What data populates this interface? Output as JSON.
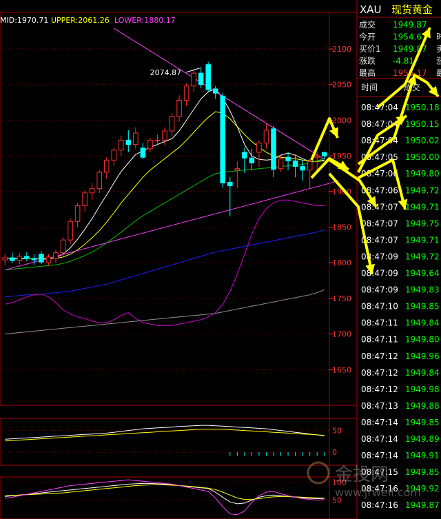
{
  "chart_data": {
    "type": "candlestick",
    "indicator_header": {
      "mid_label": "MID:1970.71",
      "upper_label": "UPPER:2061.26",
      "lower_label": "LOWER:1880.17"
    },
    "price_axis": {
      "ylim": [
        1600,
        2130
      ],
      "ticks": [
        2100,
        2050,
        2000,
        1950,
        1900,
        1850,
        1800,
        1750,
        1700,
        1650
      ]
    },
    "annotation": {
      "label": "2074.87",
      "price": 2074.87
    },
    "candles": [
      {
        "o": 1804,
        "h": 1812,
        "l": 1796,
        "c": 1807
      },
      {
        "o": 1807,
        "h": 1814,
        "l": 1800,
        "c": 1803
      },
      {
        "o": 1803,
        "h": 1813,
        "l": 1798,
        "c": 1809
      },
      {
        "o": 1809,
        "h": 1815,
        "l": 1802,
        "c": 1806
      },
      {
        "o": 1806,
        "h": 1812,
        "l": 1797,
        "c": 1804
      },
      {
        "o": 1812,
        "h": 1816,
        "l": 1798,
        "c": 1801
      },
      {
        "o": 1800,
        "h": 1812,
        "l": 1796,
        "c": 1808
      },
      {
        "o": 1806,
        "h": 1818,
        "l": 1800,
        "c": 1814
      },
      {
        "o": 1814,
        "h": 1836,
        "l": 1810,
        "c": 1832
      },
      {
        "o": 1832,
        "h": 1862,
        "l": 1826,
        "c": 1858
      },
      {
        "o": 1858,
        "h": 1884,
        "l": 1850,
        "c": 1880
      },
      {
        "o": 1880,
        "h": 1902,
        "l": 1872,
        "c": 1898
      },
      {
        "o": 1898,
        "h": 1912,
        "l": 1888,
        "c": 1904
      },
      {
        "o": 1904,
        "h": 1930,
        "l": 1898,
        "c": 1927
      },
      {
        "o": 1927,
        "h": 1948,
        "l": 1918,
        "c": 1944
      },
      {
        "o": 1944,
        "h": 1962,
        "l": 1936,
        "c": 1958
      },
      {
        "o": 1958,
        "h": 1978,
        "l": 1950,
        "c": 1972
      },
      {
        "o": 1972,
        "h": 1986,
        "l": 1955,
        "c": 1966
      },
      {
        "o": 1966,
        "h": 1990,
        "l": 1960,
        "c": 1982
      },
      {
        "o": 1961,
        "h": 1968,
        "l": 1945,
        "c": 1948
      },
      {
        "o": 1960,
        "h": 1975,
        "l": 1955,
        "c": 1972
      },
      {
        "o": 1972,
        "h": 1980,
        "l": 1966,
        "c": 1972
      },
      {
        "o": 1972,
        "h": 1990,
        "l": 1965,
        "c": 1985
      },
      {
        "o": 1985,
        "h": 2010,
        "l": 1978,
        "c": 2005
      },
      {
        "o": 2005,
        "h": 2035,
        "l": 1998,
        "c": 2028
      },
      {
        "o": 2028,
        "h": 2052,
        "l": 2020,
        "c": 2048
      },
      {
        "o": 2048,
        "h": 2072,
        "l": 2040,
        "c": 2066
      },
      {
        "o": 2066,
        "h": 2074.87,
        "l": 2045,
        "c": 2050
      },
      {
        "o": 2078,
        "h": 2082,
        "l": 2040,
        "c": 2043
      },
      {
        "o": 2044,
        "h": 2048,
        "l": 2030,
        "c": 2038
      },
      {
        "o": 2034,
        "h": 2038,
        "l": 1905,
        "c": 1912
      },
      {
        "o": 1913,
        "h": 1920,
        "l": 1865,
        "c": 1908
      },
      {
        "o": 1930,
        "h": 1942,
        "l": 1905,
        "c": 1932
      },
      {
        "o": 1955,
        "h": 1962,
        "l": 1926,
        "c": 1947
      },
      {
        "o": 1947,
        "h": 1960,
        "l": 1930,
        "c": 1940
      },
      {
        "o": 1955,
        "h": 1972,
        "l": 1935,
        "c": 1968
      },
      {
        "o": 1968,
        "h": 1995,
        "l": 1960,
        "c": 1986
      },
      {
        "o": 1988,
        "h": 1992,
        "l": 1920,
        "c": 1931
      },
      {
        "o": 1932,
        "h": 1950,
        "l": 1928,
        "c": 1946
      },
      {
        "o": 1948,
        "h": 1955,
        "l": 1930,
        "c": 1943
      },
      {
        "o": 1943,
        "h": 1950,
        "l": 1920,
        "c": 1935
      },
      {
        "o": 1935,
        "h": 1945,
        "l": 1915,
        "c": 1930
      },
      {
        "o": 1930,
        "h": 1946,
        "l": 1905,
        "c": 1942
      },
      {
        "o": 1948,
        "h": 1955,
        "l": 1930,
        "c": 1950
      },
      {
        "o": 1954.6,
        "h": 1956.2,
        "l": 1945,
        "c": 1949.87
      }
    ],
    "moving_averages": [
      {
        "color": "#ffffff",
        "values": [
          1806,
          1806,
          1805,
          1806,
          1806,
          1806,
          1805,
          1807,
          1812,
          1821,
          1833,
          1847,
          1862,
          1879,
          1895,
          1912,
          1928,
          1940,
          1952,
          1957,
          1962,
          1966,
          1970,
          1974,
          1985,
          2000,
          2015,
          2030,
          2040,
          2044,
          2031,
          2013,
          1991,
          1966,
          1950,
          1945,
          1944,
          1945,
          1951,
          1954,
          1951,
          1946,
          1942,
          1942,
          1944
        ]
      },
      {
        "color": "#ffff00",
        "values": [
          1806,
          1806,
          1806,
          1806,
          1806,
          1806,
          1806,
          1806,
          1808,
          1812,
          1818,
          1826,
          1835,
          1845,
          1857,
          1870,
          1884,
          1896,
          1908,
          1920,
          1930,
          1938,
          1946,
          1954,
          1962,
          1972,
          1983,
          1994,
          2004,
          2012,
          2010,
          2002,
          1991,
          1980,
          1970,
          1962,
          1955,
          1950,
          1948,
          1947,
          1946,
          1944,
          1943,
          1942,
          1943
        ]
      },
      {
        "color": "#00c000",
        "values": [
          1790,
          1791,
          1792,
          1793,
          1794,
          1795,
          1796,
          1797,
          1799,
          1802,
          1806,
          1810,
          1815,
          1821,
          1828,
          1835,
          1843,
          1851,
          1859,
          1866,
          1872,
          1878,
          1884,
          1890,
          1896,
          1902,
          1908,
          1914,
          1920,
          1925,
          1927,
          1928,
          1929,
          1930,
          1931,
          1932,
          1933,
          1934,
          1935,
          1936,
          1937,
          1938,
          1940,
          1943,
          1946
        ]
      },
      {
        "color": "#2020ff",
        "values": [
          1752,
          1753,
          1754,
          1755,
          1755,
          1756,
          1757,
          1758,
          1759,
          1760,
          1762,
          1764,
          1766,
          1768,
          1770,
          1773,
          1776,
          1779,
          1782,
          1785,
          1788,
          1791,
          1794,
          1797,
          1800,
          1803,
          1806,
          1809,
          1812,
          1815,
          1817,
          1819,
          1821,
          1823,
          1825,
          1827,
          1829,
          1831,
          1833,
          1835,
          1837,
          1839,
          1841,
          1843,
          1846
        ]
      },
      {
        "color": "#909090",
        "values": [
          1700,
          1701,
          1702,
          1703,
          1704,
          1705,
          1706,
          1707,
          1708,
          1709,
          1710,
          1711,
          1712,
          1713,
          1714,
          1715,
          1716,
          1717,
          1718,
          1719,
          1720,
          1721,
          1722,
          1723,
          1724,
          1725,
          1726,
          1727,
          1728,
          1729,
          1731,
          1733,
          1735,
          1737,
          1739,
          1741,
          1743,
          1745,
          1747,
          1749,
          1751,
          1753,
          1755,
          1758,
          1762
        ]
      },
      {
        "color": "#d000d0",
        "values": [
          1742,
          1744,
          1748,
          1752,
          1755,
          1756,
          1752,
          1744,
          1734,
          1728,
          1724,
          1722,
          1718,
          1716,
          1716,
          1720,
          1726,
          1730,
          1722,
          1716,
          1714,
          1712,
          1712,
          1712,
          1714,
          1716,
          1718,
          1720,
          1724,
          1730,
          1742,
          1760,
          1784,
          1812,
          1840,
          1862,
          1876,
          1884,
          1888,
          1888,
          1886,
          1884,
          1882,
          1880,
          1880
        ]
      }
    ],
    "trendlines": [
      {
        "color": "#ff40ff",
        "from": [
          15,
          2129
        ],
        "to": [
          44,
          1945
        ]
      },
      {
        "color": "#ff40ff",
        "from": [
          0,
          1790
        ],
        "to": [
          46,
          1915
        ]
      }
    ],
    "macd_panel": {
      "ticks": [
        50,
        0
      ],
      "ylim": [
        -25,
        70
      ],
      "dif": [
        30,
        31,
        32,
        33,
        34,
        35,
        36,
        37,
        38,
        39,
        40,
        41,
        42,
        43,
        44,
        46,
        48,
        50,
        52,
        54,
        55,
        56,
        57,
        58,
        59,
        60,
        61,
        62,
        62,
        61,
        60,
        59,
        58,
        57,
        56,
        55,
        54,
        52,
        50,
        48,
        46,
        44,
        42,
        40,
        38
      ],
      "dea": [
        26,
        27,
        28,
        29,
        30,
        31,
        32,
        33,
        34,
        35,
        36,
        37,
        38,
        39,
        40,
        41,
        42,
        43,
        44,
        45,
        46,
        47,
        48,
        49,
        50,
        51,
        52,
        53,
        53,
        53,
        53,
        52,
        51,
        50,
        49,
        48,
        47,
        46,
        45,
        44,
        43,
        42,
        41,
        40,
        39
      ],
      "histogram": [
        0,
        0,
        0,
        0,
        0,
        0,
        0,
        0,
        0,
        0,
        0,
        0,
        0,
        0,
        0,
        0,
        0,
        0,
        0,
        0,
        0,
        0,
        0,
        0,
        0,
        0,
        0,
        0,
        0,
        0,
        0,
        -8,
        -8,
        -8,
        -8,
        -8,
        -8,
        -8,
        -8,
        -8,
        -8,
        -8,
        -8,
        -8,
        -8
      ]
    },
    "kdj_panel": {
      "ticks": [
        100,
        50
      ],
      "ylim": [
        0,
        110
      ],
      "k": [
        60,
        62,
        64,
        66,
        68,
        70,
        72,
        74,
        76,
        78,
        80,
        82,
        84,
        86,
        88,
        90,
        92,
        94,
        95,
        96,
        96,
        95,
        94,
        92,
        90,
        88,
        86,
        84,
        82,
        72,
        58,
        45,
        40,
        42,
        50,
        58,
        62,
        64,
        62,
        60,
        58,
        56,
        55,
        54,
        55
      ],
      "d": [
        62,
        63,
        64,
        65,
        66,
        67,
        68,
        69,
        70,
        72,
        74,
        76,
        78,
        80,
        82,
        84,
        86,
        88,
        90,
        91,
        92,
        92,
        92,
        91,
        90,
        89,
        87,
        85,
        83,
        79,
        72,
        64,
        56,
        52,
        52,
        54,
        57,
        59,
        60,
        60,
        59,
        58,
        57,
        56,
        56
      ],
      "j": [
        55,
        58,
        62,
        66,
        70,
        74,
        78,
        82,
        86,
        90,
        92,
        94,
        96,
        98,
        100,
        102,
        104,
        106,
        104,
        102,
        100,
        98,
        96,
        94,
        90,
        86,
        82,
        78,
        74,
        56,
        32,
        12,
        10,
        20,
        44,
        62,
        72,
        74,
        68,
        62,
        58,
        54,
        52,
        50,
        52
      ]
    }
  },
  "quote_panel": {
    "symbol": "XAU",
    "name": "现货黄金",
    "rows": [
      {
        "label": "成交",
        "value": "1949.87",
        "right": ""
      },
      {
        "label": "今开",
        "value": "1954.67",
        "right": "时"
      },
      {
        "label": "买价1",
        "value": "1949.87",
        "right": "卖"
      },
      {
        "label": "涨跌",
        "value": "-4.81",
        "right": "涨"
      },
      {
        "label": "最高",
        "value": "1955.17",
        "right": "最"
      }
    ],
    "ticks_header": {
      "time": "时间",
      "price": "成交"
    },
    "ticks": [
      {
        "time": "08:47:04",
        "price": "1950.18",
        "color": "#00ff00"
      },
      {
        "time": "08:47:04",
        "price": "1950.15",
        "color": "#00ff00"
      },
      {
        "time": "08:47:04",
        "price": "1950.02",
        "color": "#00ff00"
      },
      {
        "time": "08:47:05",
        "price": "1950.00",
        "color": "#00ff00"
      },
      {
        "time": "08:47:06",
        "price": "1949.80",
        "color": "#00ff00"
      },
      {
        "time": "08:47:06",
        "price": "1949.72",
        "color": "#00ff00"
      },
      {
        "time": "08:47:07",
        "price": "1949.71",
        "color": "#00ff00"
      },
      {
        "time": "08:47:07",
        "price": "1949.75",
        "color": "#00ff00"
      },
      {
        "time": "08:47:07",
        "price": "1949.71",
        "color": "#00ff00"
      },
      {
        "time": "08:47:09",
        "price": "1949.72",
        "color": "#00ff00"
      },
      {
        "time": "08:47:09",
        "price": "1949.64",
        "color": "#00ff00"
      },
      {
        "time": "08:47:09",
        "price": "1949.83",
        "color": "#00ff00"
      },
      {
        "time": "08:47:10",
        "price": "1949.85",
        "color": "#00ff00"
      },
      {
        "time": "08:47:11",
        "price": "1949.84",
        "color": "#00ff00"
      },
      {
        "time": "08:47:11",
        "price": "1949.80",
        "color": "#00ff00"
      },
      {
        "time": "08:47:12",
        "price": "1949.96",
        "color": "#00ff00"
      },
      {
        "time": "08:47:12",
        "price": "1949.84",
        "color": "#00ff00"
      },
      {
        "time": "08:47:12",
        "price": "1949.98",
        "color": "#00ff00"
      },
      {
        "time": "08:47:13",
        "price": "1949.88",
        "color": "#00ff00"
      },
      {
        "time": "08:47:14",
        "price": "1949.85",
        "color": "#00ff00"
      },
      {
        "time": "08:47:14",
        "price": "1949.89",
        "color": "#00ff00"
      },
      {
        "time": "08:47:14",
        "price": "1949.91",
        "color": "#00ff00"
      },
      {
        "time": "08:47:15",
        "price": "1949.85",
        "color": "#00ff00"
      },
      {
        "time": "08:47:16",
        "price": "1949.92",
        "color": "#00ff00"
      },
      {
        "time": "08:47:16",
        "price": "1949.87",
        "color": "#00ff00"
      }
    ]
  },
  "watermark": {
    "brand": "金投网",
    "url": "www.jrwell.com"
  },
  "colors": {
    "up": "#ff3030",
    "down": "#00ffff",
    "axis": "#ff3030",
    "grid": "#8a0000",
    "yellow": "#ffff00",
    "green": "#00ff00",
    "annotation": "#ffff40"
  }
}
